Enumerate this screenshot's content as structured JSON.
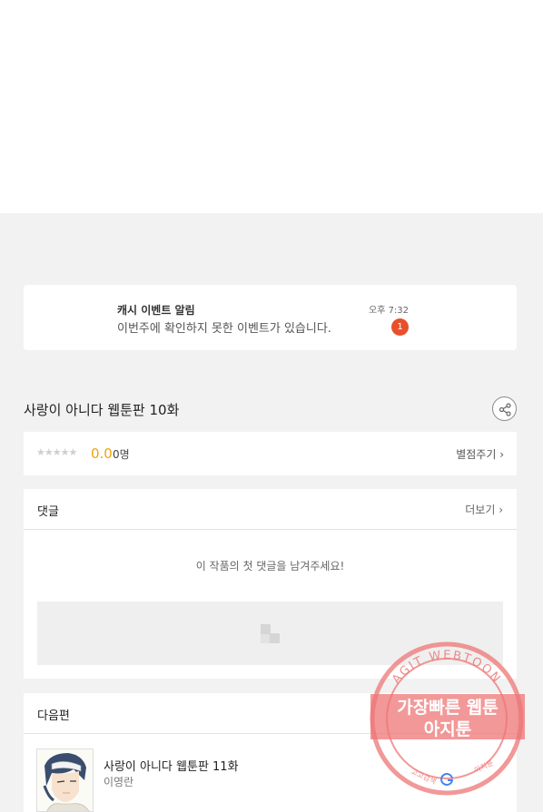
{
  "notification": {
    "title": "캐시 이벤트 알림",
    "message": "이번주에 확인하지 못한 이벤트가 있습니다.",
    "time": "오후 7:32",
    "badge": "1"
  },
  "episode": {
    "title": "사랑이 아니다 웹툰판 10화"
  },
  "rating": {
    "stars": "★★★★★",
    "score": "0.0",
    "count": "0명",
    "rate_link": "별점주기 ›"
  },
  "comments": {
    "label": "댓글",
    "more": "더보기 ›",
    "empty_message": "이 작품의 첫 댓글을 남겨주세요!"
  },
  "next_episode": {
    "label": "다음편",
    "title": "사랑이 아니다 웹툰판 11화",
    "author": "이영란"
  },
  "watermark": {
    "arc_text": "AGIT WEBTOON",
    "line1": "가장빠른 웹툰",
    "line2": "아지툰",
    "bottom_left": "고고검색",
    "bottom_right": "아지툰"
  },
  "colors": {
    "badge": "#e8502c",
    "score": "#f0a30a",
    "watermark": "#ee7676"
  },
  "icons": [
    "share-icon",
    "ad-placeholder-icon",
    "star-icon",
    "chevron-right-icon",
    "google-g-icon"
  ]
}
